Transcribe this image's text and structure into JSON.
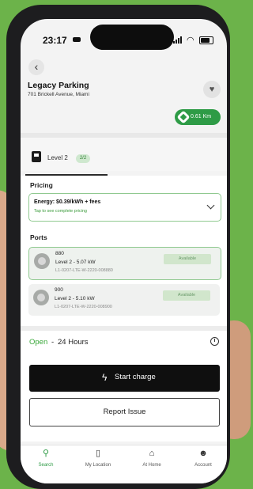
{
  "status_bar": {
    "time": "23:17"
  },
  "location": {
    "title": "Legacy Parking",
    "address": "701 Brickell Avenue, Miami",
    "distance": "0.61 Km"
  },
  "tab": {
    "label": "Level 2",
    "badge": "2/2"
  },
  "pricing": {
    "label": "Pricing",
    "main": "Energy: $0.39/kWh + fees",
    "sub": "Tap to see complete pricing"
  },
  "ports": {
    "label": "Ports",
    "items": [
      {
        "id": "880",
        "power": "Level 2 - 5.07 kW",
        "serial": "L1-0207-LTE-W-2220-008880",
        "status": "Available",
        "selected": true
      },
      {
        "id": "900",
        "power": "Level 2 - 5.10 kW",
        "serial": "L1-0207-LTE-W-2220-008900",
        "status": "Available",
        "selected": false
      }
    ]
  },
  "hours": {
    "open": "Open",
    "dash": "-",
    "value": "24 Hours"
  },
  "actions": {
    "start_charge": "Start charge",
    "report_issue": "Report Issue"
  },
  "nav": {
    "items": [
      {
        "label": "Search",
        "icon": "search-icon",
        "active": true
      },
      {
        "label": "My Location",
        "icon": "charger-icon",
        "active": false
      },
      {
        "label": "At Home",
        "icon": "home-icon",
        "active": false
      },
      {
        "label": "Account",
        "icon": "account-icon",
        "active": false
      }
    ]
  },
  "colors": {
    "accent": "#2e9b46",
    "background": "#6cb34a",
    "button_dark": "#0f0f0f"
  }
}
